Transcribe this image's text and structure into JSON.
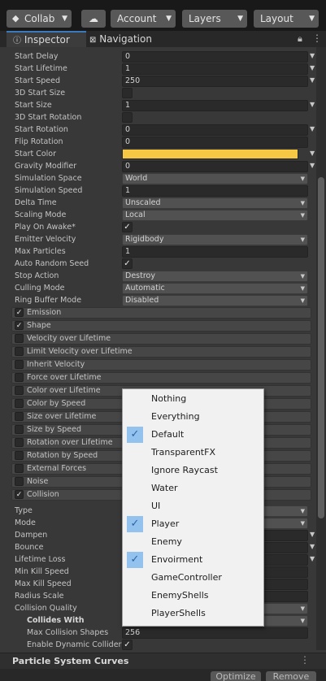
{
  "toolbar": {
    "collab": "Collab",
    "account": "Account",
    "layers": "Layers",
    "layout": "Layout"
  },
  "tabs": {
    "inspector": "Inspector",
    "navigation": "Navigation"
  },
  "properties": [
    {
      "label": "Start Delay",
      "value": "0",
      "kind": "field",
      "mini": true
    },
    {
      "label": "Start Lifetime",
      "value": "1",
      "kind": "field",
      "mini": true
    },
    {
      "label": "Start Speed",
      "value": "250",
      "kind": "field",
      "mini": true
    },
    {
      "label": "3D Start Size",
      "value": "",
      "kind": "check",
      "checked": false
    },
    {
      "label": "Start Size",
      "value": "1",
      "kind": "field",
      "mini": true
    },
    {
      "label": "3D Start Rotation",
      "value": "",
      "kind": "check",
      "checked": false
    },
    {
      "label": "Start Rotation",
      "value": "0",
      "kind": "field",
      "mini": true
    },
    {
      "label": "Flip Rotation",
      "value": "0",
      "kind": "field",
      "mini": false
    },
    {
      "label": "Start Color",
      "value": "",
      "kind": "color",
      "mini": true
    },
    {
      "label": "Gravity Modifier",
      "value": "0",
      "kind": "field",
      "mini": true
    },
    {
      "label": "Simulation Space",
      "value": "World",
      "kind": "popup"
    },
    {
      "label": "Simulation Speed",
      "value": "1",
      "kind": "field",
      "mini": false
    },
    {
      "label": "Delta Time",
      "value": "Unscaled",
      "kind": "popup"
    },
    {
      "label": "Scaling Mode",
      "value": "Local",
      "kind": "popup"
    },
    {
      "label": "Play On Awake*",
      "value": "",
      "kind": "check",
      "checked": true
    },
    {
      "label": "Emitter Velocity",
      "value": "Rigidbody",
      "kind": "popup"
    },
    {
      "label": "Max Particles",
      "value": "1",
      "kind": "field",
      "mini": false
    },
    {
      "label": "Auto Random Seed",
      "value": "",
      "kind": "check",
      "checked": true
    },
    {
      "label": "Stop Action",
      "value": "Destroy",
      "kind": "popup"
    },
    {
      "label": "Culling Mode",
      "value": "Automatic",
      "kind": "popup"
    },
    {
      "label": "Ring Buffer Mode",
      "value": "Disabled",
      "kind": "popup"
    }
  ],
  "start_color": "#f7c843",
  "modules": [
    {
      "label": "Emission",
      "checked": true
    },
    {
      "label": "Shape",
      "checked": true
    },
    {
      "label": "Velocity over Lifetime",
      "checked": false
    },
    {
      "label": "Limit Velocity over Lifetime",
      "checked": false
    },
    {
      "label": "Inherit Velocity",
      "checked": false
    },
    {
      "label": "Force over Lifetime",
      "checked": false
    },
    {
      "label": "Color over Lifetime",
      "checked": false
    },
    {
      "label": "Color by Speed",
      "checked": false
    },
    {
      "label": "Size over Lifetime",
      "checked": false
    },
    {
      "label": "Size by Speed",
      "checked": false
    },
    {
      "label": "Rotation over Lifetime",
      "checked": false
    },
    {
      "label": "Rotation by Speed",
      "checked": false
    },
    {
      "label": "External Forces",
      "checked": false
    },
    {
      "label": "Noise",
      "checked": false
    },
    {
      "label": "Collision",
      "checked": true
    }
  ],
  "collision": [
    {
      "label": "Type",
      "value": "",
      "kind": "popup"
    },
    {
      "label": "Mode",
      "value": "",
      "kind": "popup"
    },
    {
      "label": "Dampen",
      "value": "",
      "kind": "field",
      "mini": true
    },
    {
      "label": "Bounce",
      "value": "",
      "kind": "field",
      "mini": true
    },
    {
      "label": "Lifetime Loss",
      "value": "",
      "kind": "field",
      "mini": true
    },
    {
      "label": "Min Kill Speed",
      "value": "",
      "kind": "field",
      "mini": false
    },
    {
      "label": "Max Kill Speed",
      "value": "",
      "kind": "field",
      "mini": false
    },
    {
      "label": "Radius Scale",
      "value": "",
      "kind": "field",
      "mini": false
    },
    {
      "label": "Collision Quality",
      "value": "",
      "kind": "popup"
    }
  ],
  "collision_sub": [
    {
      "label": "Collides With",
      "value": "",
      "kind": "popup",
      "bold": true
    },
    {
      "label": "Max Collision Shapes",
      "value": "256",
      "kind": "field"
    },
    {
      "label": "Enable Dynamic Colliders",
      "value": "",
      "kind": "check",
      "checked": true
    }
  ],
  "curves_title": "Particle System Curves",
  "bottom": {
    "optimize": "Optimize",
    "remove": "Remove"
  },
  "layer_menu": [
    {
      "label": "Nothing",
      "checked": false
    },
    {
      "label": "Everything",
      "checked": false
    },
    {
      "label": "Default",
      "checked": true
    },
    {
      "label": "TransparentFX",
      "checked": false
    },
    {
      "label": "Ignore Raycast",
      "checked": false
    },
    {
      "label": "Water",
      "checked": false
    },
    {
      "label": "UI",
      "checked": false
    },
    {
      "label": "Player",
      "checked": true
    },
    {
      "label": "Enemy",
      "checked": false
    },
    {
      "label": "Envoirment",
      "checked": true
    },
    {
      "label": "GameController",
      "checked": false
    },
    {
      "label": "EnemyShells",
      "checked": false
    },
    {
      "label": "PlayerShells",
      "checked": false
    }
  ]
}
